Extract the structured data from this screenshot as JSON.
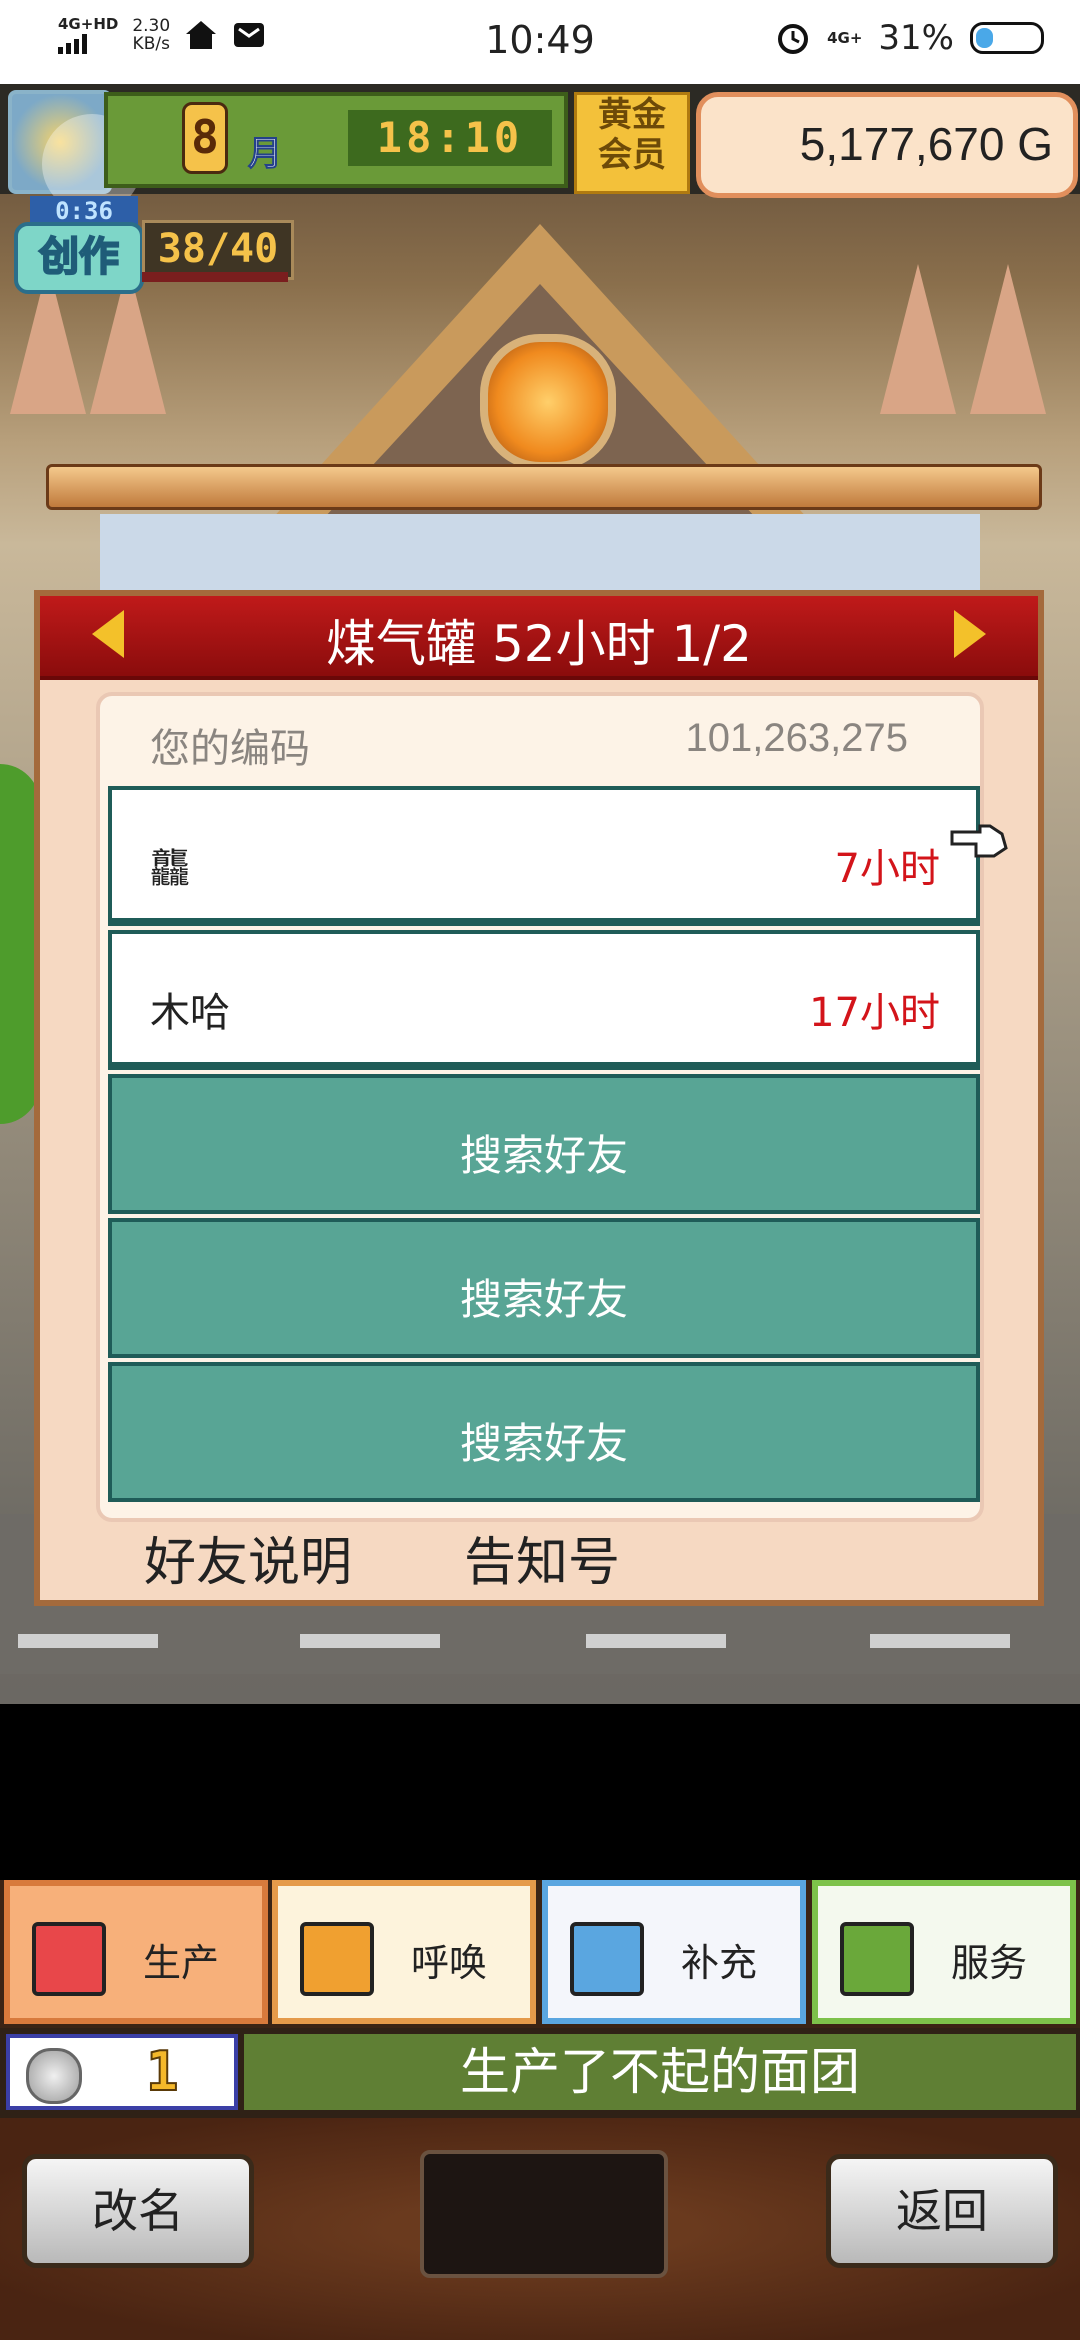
{
  "status_bar": {
    "network": "4G+HD",
    "speed_value": "2.30",
    "speed_unit": "KB/s",
    "time": "10:49",
    "network2": "4G+",
    "battery": "31%",
    "battery_level": 0.31,
    "icons": [
      "home-icon",
      "message-icon",
      "alarm-icon"
    ]
  },
  "hud": {
    "month": "8",
    "month_label": "月",
    "clock": "18:10",
    "vip_line1": "黄金",
    "vip_line2": "会员",
    "gold": "5,177,670 G",
    "create_timer": "0:36",
    "create_label": "创作",
    "create_count": "38/40"
  },
  "dialog": {
    "title": "煤气罐  52小时 1/2",
    "code_label": "您的编码",
    "code_value": "101,263,275",
    "friends": [
      {
        "name": "龘",
        "hours": "7小时"
      },
      {
        "name": "木哈",
        "hours": "17小时"
      }
    ],
    "search_slots": [
      "搜索好友",
      "搜索好友",
      "搜索好友"
    ],
    "btn_explain": "好友说明",
    "btn_notify": "告知号"
  },
  "tabs": [
    {
      "label": "生产",
      "icon": "bread-icon",
      "bg": "#f7b07a",
      "border": "#d87a3c",
      "icon_bg": "#e8474a"
    },
    {
      "label": "呼唤",
      "icon": "megaphone-icon",
      "bg": "#fdf3dc",
      "border": "#e59a4a",
      "icon_bg": "#f0a030"
    },
    {
      "label": "补充",
      "icon": "cake-icon",
      "bg": "#f4f6fb",
      "border": "#5aa6e0",
      "icon_bg": "#5aa6e0"
    },
    {
      "label": "服务",
      "icon": "coffee-icon",
      "bg": "#f4f9ee",
      "border": "#7dc24a",
      "icon_bg": "#6aa83a"
    }
  ],
  "info": {
    "coin_count": "1",
    "message": "生产了不起的面团"
  },
  "bottom": {
    "rename": "改名",
    "back": "返回"
  }
}
